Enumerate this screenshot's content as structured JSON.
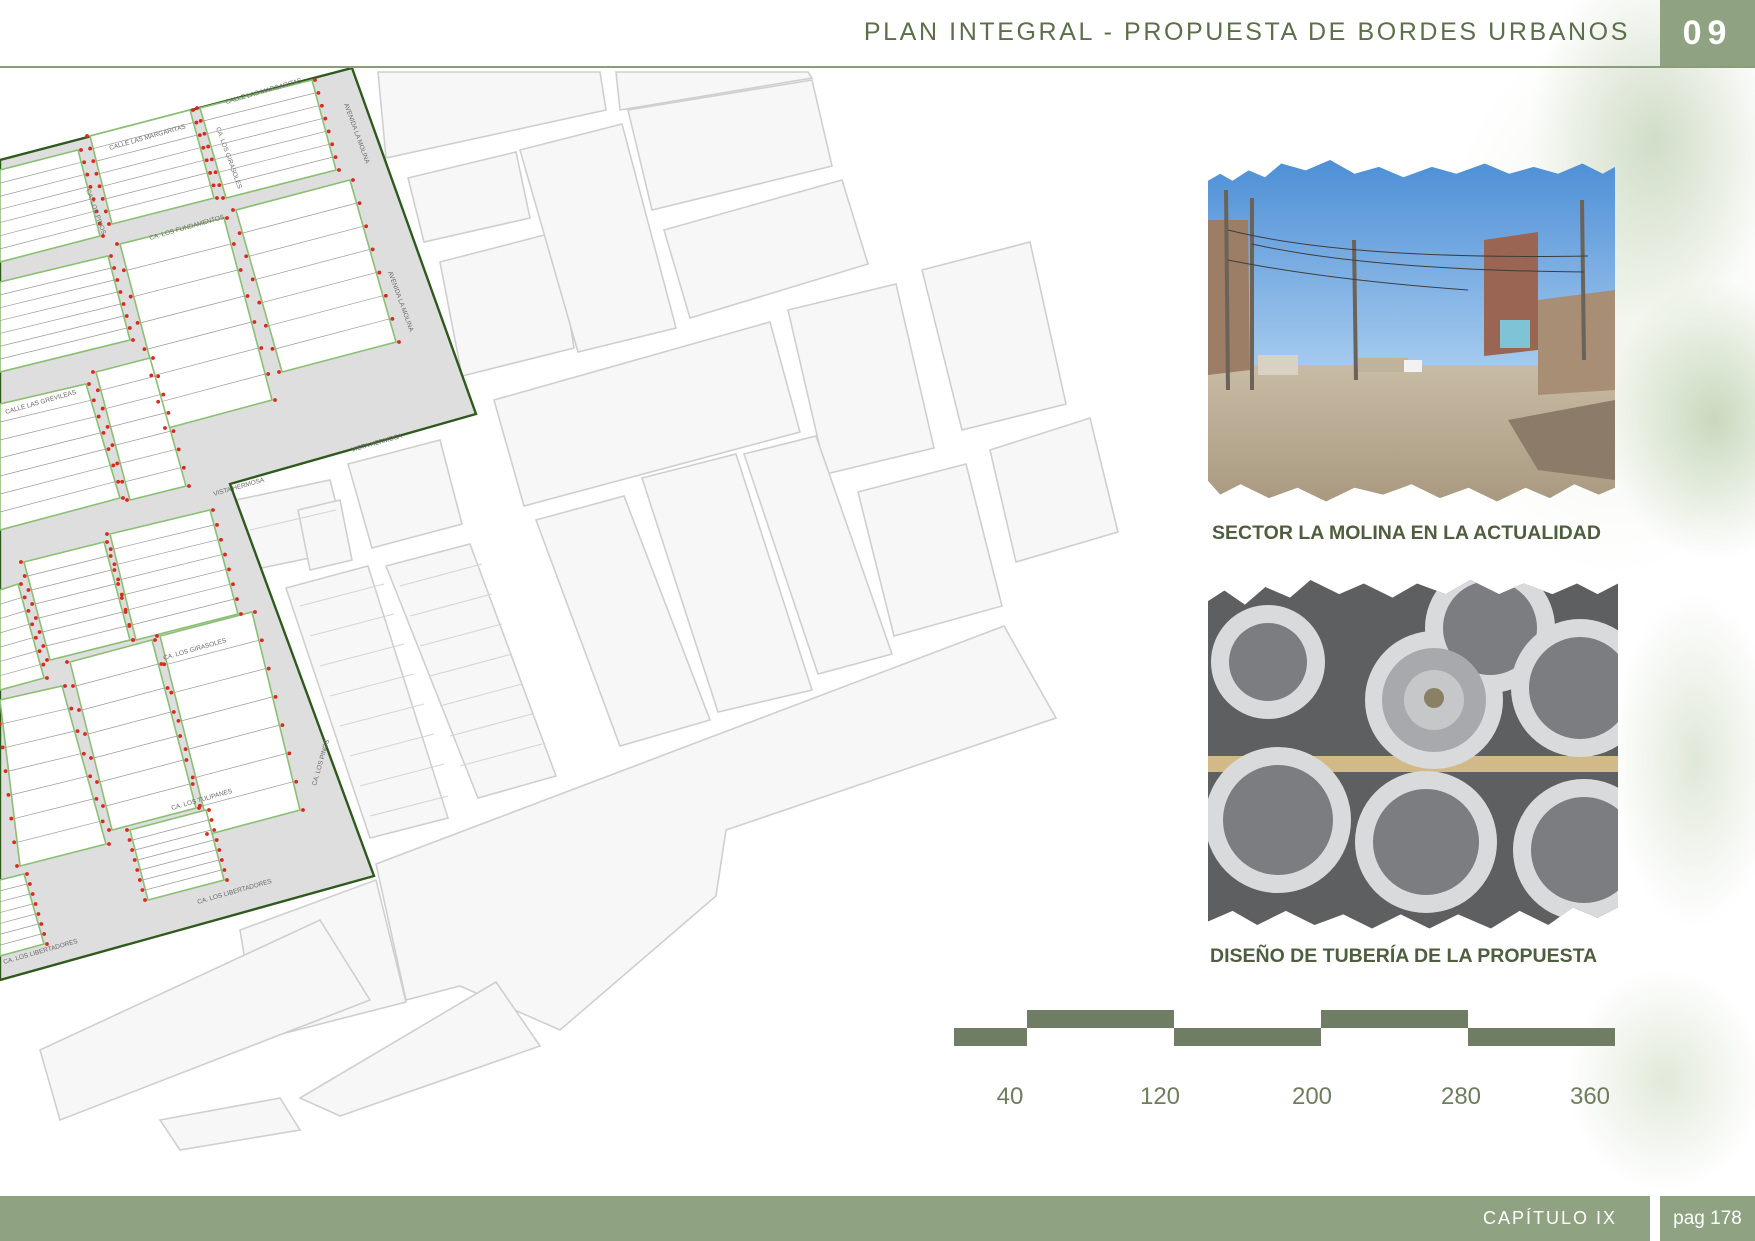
{
  "header": {
    "title": "PLAN INTEGRAL - PROPUESTA DE BORDES URBANOS",
    "chapter_number": "09"
  },
  "photos": [
    {
      "caption": "SECTOR LA MOLINA EN LA ACTUALIDAD"
    },
    {
      "caption": "DISEÑO DE TUBERÍA DE LA PROPUESTA"
    }
  ],
  "scale_bar": {
    "ticks": [
      "40",
      "120",
      "200",
      "280",
      "360"
    ],
    "color": "#6e7d63"
  },
  "footer": {
    "chapter": "CAPÍTULO IX",
    "page": "pag 178"
  },
  "map": {
    "street_labels": [
      "CALLE LAS MARGARITAS",
      "AVENIDA LA MOLINA",
      "CA. LOS GIRASOLES",
      "CA. LOS PINOS",
      "CA. LOS FUNDAMENTOS",
      "VISTA HERMOSA",
      "CALLE LAS GREVILEAS",
      "CA. LOS TULIPANES",
      "CA. LOS LIBERTADORES"
    ],
    "colors": {
      "boundary": "#2e5a1e",
      "lot_outline": "#8cbf74",
      "points": "#d82a1e"
    }
  }
}
